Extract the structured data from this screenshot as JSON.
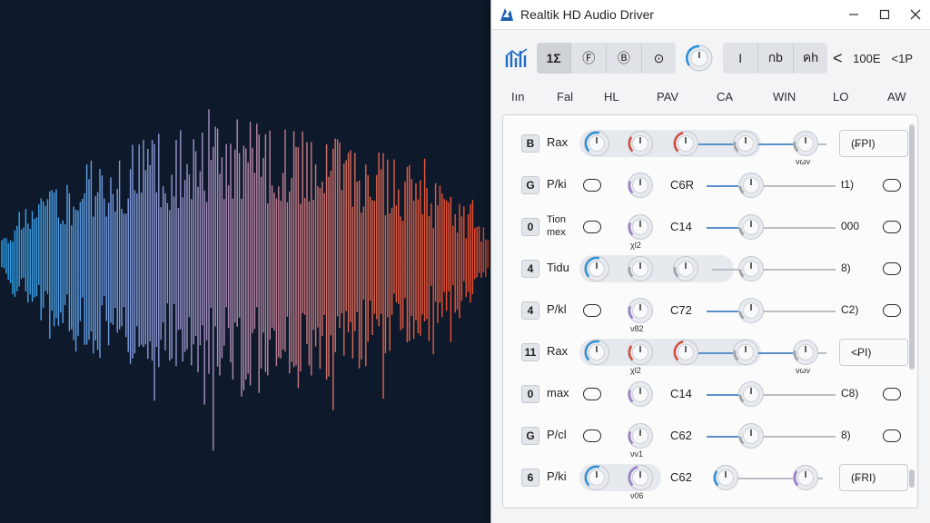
{
  "window": {
    "title": "Realtik HD Audio Driver",
    "minimize_icon": "minimize-icon",
    "maximize_icon": "maximize-icon",
    "close_icon": "close-icon"
  },
  "toolbar": {
    "group1": [
      "1Σ",
      "Ⓕ",
      "Ⓑ",
      "⊙"
    ],
    "group2": [
      "I",
      "กb",
      "คh"
    ],
    "text1": "100E",
    "text2": "<1P",
    "chevron": "<"
  },
  "columns": [
    "Iın",
    "Fal",
    "HL",
    "PAV",
    "CA",
    "WIN",
    "LO",
    "AW"
  ],
  "rows": [
    {
      "badge": "B",
      "name": "Rax",
      "mid": "",
      "right": "(FPI)",
      "type": "full",
      "subs": [
        "",
        "",
        "",
        "",
        "νων"
      ]
    },
    {
      "badge": "G",
      "name": "P/ki",
      "mid": "C6R",
      "right": "t1)",
      "type": "mid",
      "subs": []
    },
    {
      "badge": "0",
      "name": "Tion\nmex",
      "mid": "C14",
      "right": "000",
      "type": "mid",
      "subs": [
        "",
        "χl2"
      ]
    },
    {
      "badge": "4",
      "name": "Tidu",
      "mid": "",
      "right": "8)",
      "type": "full3",
      "subs": []
    },
    {
      "badge": "4",
      "name": "P/kl",
      "mid": "C72",
      "right": "C2)",
      "type": "mid",
      "subs": [
        "",
        "ν82"
      ]
    },
    {
      "badge": "11",
      "name": "Rax",
      "mid": "",
      "right": "<PI)",
      "type": "full",
      "subs": [
        "",
        "χl2",
        "",
        "",
        "νων"
      ]
    },
    {
      "badge": "0",
      "name": "max",
      "mid": "C14",
      "right": "C8)",
      "type": "mid",
      "subs": []
    },
    {
      "badge": "G",
      "name": "P/cl",
      "mid": "C62",
      "right": "8)",
      "type": "mid",
      "subs": [
        "",
        "νν1"
      ]
    },
    {
      "badge": "6",
      "name": "P/ki",
      "mid": "C62",
      "right": "(FRI)",
      "type": "end",
      "subs": [
        "",
        "ν06"
      ]
    }
  ],
  "colors": {
    "accent": "#2f8fd8",
    "red": "#d84a3a",
    "purple": "#9a7cc8"
  }
}
